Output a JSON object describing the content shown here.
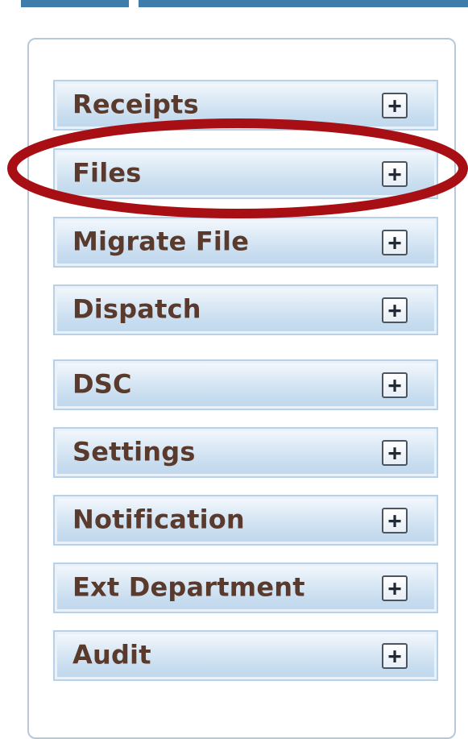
{
  "menu": {
    "items": [
      {
        "label": "Receipts",
        "expand_icon": "+"
      },
      {
        "label": "Files",
        "expand_icon": "+"
      },
      {
        "label": "Migrate File",
        "expand_icon": "+"
      },
      {
        "label": "Dispatch",
        "expand_icon": "+"
      },
      {
        "label": "DSC",
        "expand_icon": "+"
      },
      {
        "label": "Settings",
        "expand_icon": "+"
      },
      {
        "label": "Notification",
        "expand_icon": "+"
      },
      {
        "label": "Ext Department",
        "expand_icon": "+"
      },
      {
        "label": "Audit",
        "expand_icon": "+"
      }
    ]
  },
  "highlight": {
    "target": "Files",
    "color": "#a80f14"
  },
  "colors": {
    "tab_accent": "#3e7cab",
    "item_text": "#5a3a2c",
    "item_border": "#b9d1e6",
    "panel_border": "#b7c9d9"
  }
}
